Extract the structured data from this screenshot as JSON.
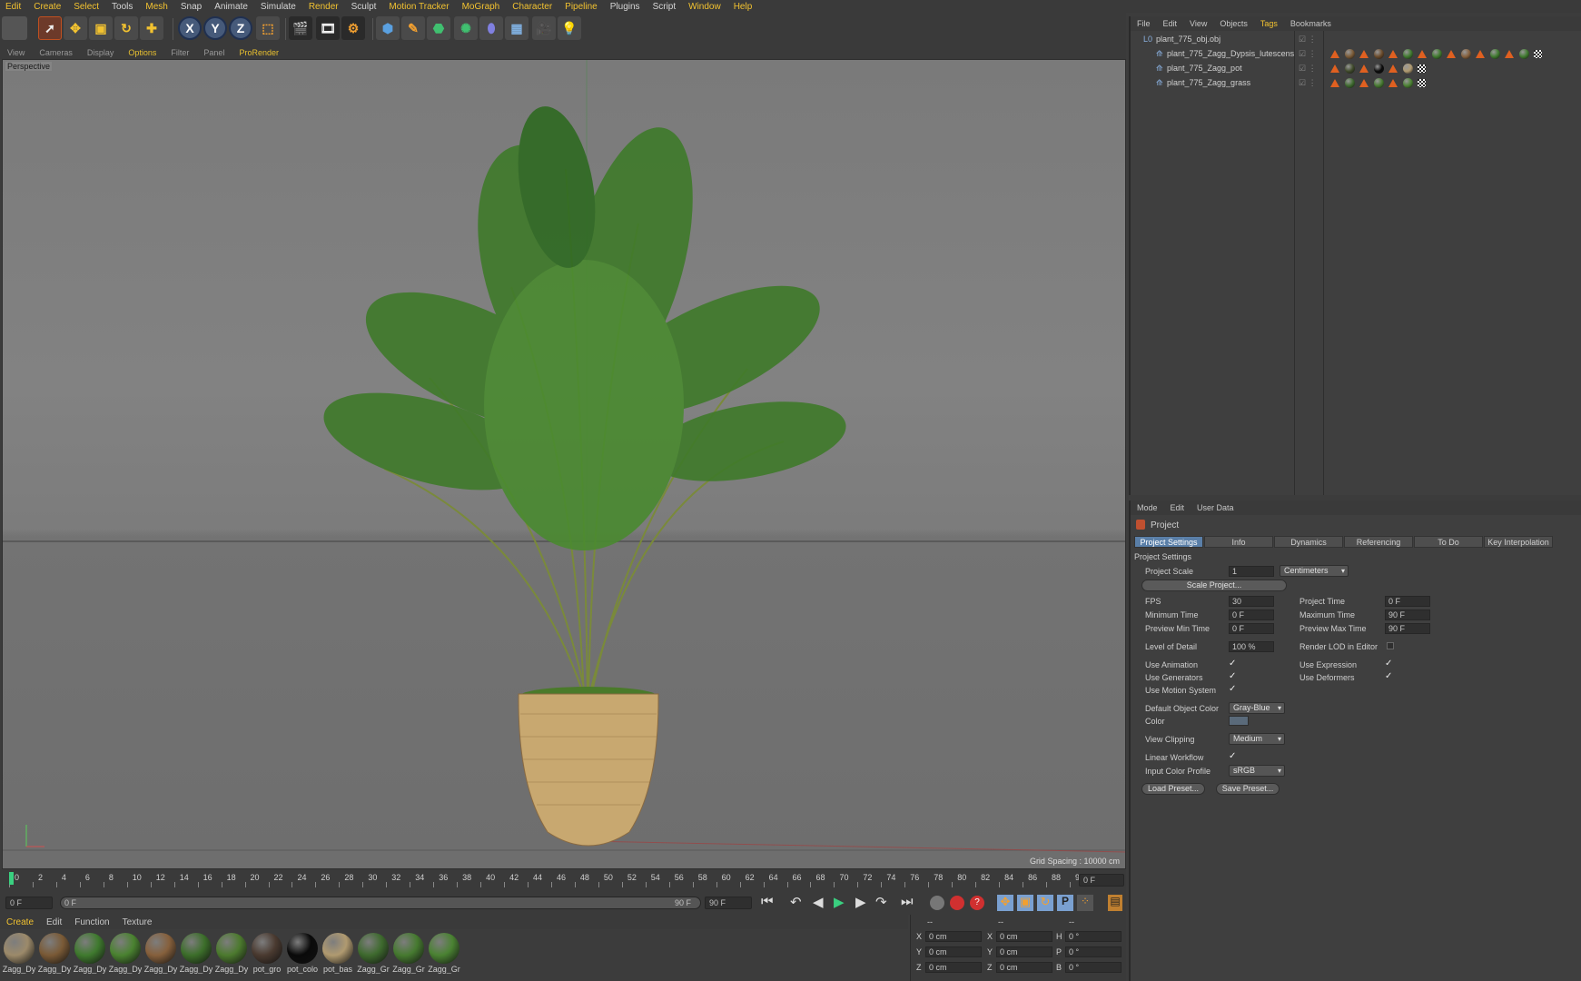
{
  "menubar": {
    "items": [
      "Edit",
      "Create",
      "Select",
      "Tools",
      "Mesh",
      "Snap",
      "Animate",
      "Simulate",
      "Render",
      "Sculpt",
      "Motion Tracker",
      "MoGraph",
      "Character",
      "Pipeline",
      "Plugins",
      "Script",
      "Window",
      "Help"
    ],
    "highlight": [
      "Edit",
      "Create",
      "Select",
      "Mesh",
      "Render",
      "Motion Tracker",
      "MoGraph",
      "Character",
      "Pipeline",
      "Window",
      "Help"
    ]
  },
  "toolbar": {
    "axis_x": "X",
    "axis_y": "Y",
    "axis_z": "Z"
  },
  "viewport": {
    "menu": [
      "View",
      "Cameras",
      "Display",
      "Options",
      "Filter",
      "Panel",
      "ProRender"
    ],
    "highlight": [
      "Options",
      "ProRender"
    ],
    "label": "Perspective",
    "grid_spacing": "Grid Spacing : 10000 cm"
  },
  "timeline": {
    "ticks": [
      "0",
      "2",
      "4",
      "6",
      "8",
      "10",
      "12",
      "14",
      "16",
      "18",
      "20",
      "22",
      "24",
      "26",
      "28",
      "30",
      "32",
      "34",
      "36",
      "38",
      "40",
      "42",
      "44",
      "46",
      "48",
      "50",
      "52",
      "54",
      "56",
      "58",
      "60",
      "62",
      "64",
      "66",
      "68",
      "70",
      "72",
      "74",
      "76",
      "78",
      "80",
      "82",
      "84",
      "86",
      "88",
      "90"
    ],
    "current_frame": "0 F"
  },
  "transport": {
    "start_field": "0 F",
    "range_start": "0 F",
    "range_end": "90 F",
    "end_field": "90 F"
  },
  "materials": {
    "menu": [
      "Create",
      "Edit",
      "Function",
      "Texture"
    ],
    "items": [
      {
        "label": "Zagg_Dy",
        "color": "#9c8a6a"
      },
      {
        "label": "Zagg_Dy",
        "color": "#7a5a36"
      },
      {
        "label": "Zagg_Dy",
        "color": "#3f7a2e"
      },
      {
        "label": "Zagg_Dy",
        "color": "#4a8230"
      },
      {
        "label": "Zagg_Dy",
        "color": "#86603c"
      },
      {
        "label": "Zagg_Dy",
        "color": "#3c6e2a"
      },
      {
        "label": "Zagg_Dy",
        "color": "#4c7a2e"
      },
      {
        "label": "pot_gro",
        "color": "#4a3a30"
      },
      {
        "label": "pot_colo",
        "color": "#0a0a0a"
      },
      {
        "label": "pot_bas",
        "color": "#b09a70"
      },
      {
        "label": "Zagg_Gr",
        "color": "#3e6a2e"
      },
      {
        "label": "Zagg_Gr",
        "color": "#467a30"
      },
      {
        "label": "Zagg_Gr",
        "color": "#4a8232"
      }
    ]
  },
  "coords": {
    "headers": [
      "--",
      "--",
      "--"
    ],
    "rows": [
      {
        "a": "X",
        "av": "0 cm",
        "b": "X",
        "bv": "0 cm",
        "c": "H",
        "cv": "0 °"
      },
      {
        "a": "Y",
        "av": "0 cm",
        "b": "Y",
        "bv": "0 cm",
        "c": "P",
        "cv": "0 °"
      },
      {
        "a": "Z",
        "av": "0 cm",
        "b": "Z",
        "bv": "0 cm",
        "c": "B",
        "cv": "0 °"
      }
    ]
  },
  "objects": {
    "menu": [
      "File",
      "Edit",
      "View",
      "Objects",
      "Tags",
      "Bookmarks"
    ],
    "highlight": [
      "Tags"
    ],
    "rows": [
      {
        "name": "plant_775_obj.obj"
      },
      {
        "name": "plant_775_Zagg_Dypsis_lutescens"
      },
      {
        "name": "plant_775_Zagg_pot"
      },
      {
        "name": "plant_775_Zagg_grass"
      }
    ]
  },
  "attributes": {
    "menu": [
      "Mode",
      "Edit",
      "User Data"
    ],
    "object": "Project",
    "tabs": [
      "Project Settings",
      "Info",
      "Dynamics",
      "Referencing",
      "To Do",
      "Key Interpolation"
    ],
    "section": "Project Settings",
    "project_scale_label": "Project Scale",
    "project_scale": "1",
    "scale_unit": "Centimeters",
    "scale_button": "Scale Project...",
    "fps_label": "FPS",
    "fps": "30",
    "project_time_label": "Project Time",
    "project_time": "0 F",
    "min_time_label": "Minimum Time",
    "min_time": "0 F",
    "max_time_label": "Maximum Time",
    "max_time": "90 F",
    "pmin_label": "Preview Min Time",
    "pmin": "0 F",
    "pmax_label": "Preview Max Time",
    "pmax": "90 F",
    "lod_label": "Level of Detail",
    "lod": "100 %",
    "render_lod_label": "Render LOD in Editor",
    "use_anim_label": "Use Animation",
    "use_expr_label": "Use Expression",
    "use_gen_label": "Use Generators",
    "use_def_label": "Use Deformers",
    "use_motion_label": "Use Motion System",
    "def_color_label": "Default Object Color",
    "def_color": "Gray-Blue",
    "color_label": "Color",
    "view_clip_label": "View Clipping",
    "view_clip": "Medium",
    "linear_label": "Linear Workflow",
    "icp_label": "Input Color Profile",
    "icp": "sRGB",
    "load_preset": "Load Preset...",
    "save_preset": "Save Preset..."
  }
}
